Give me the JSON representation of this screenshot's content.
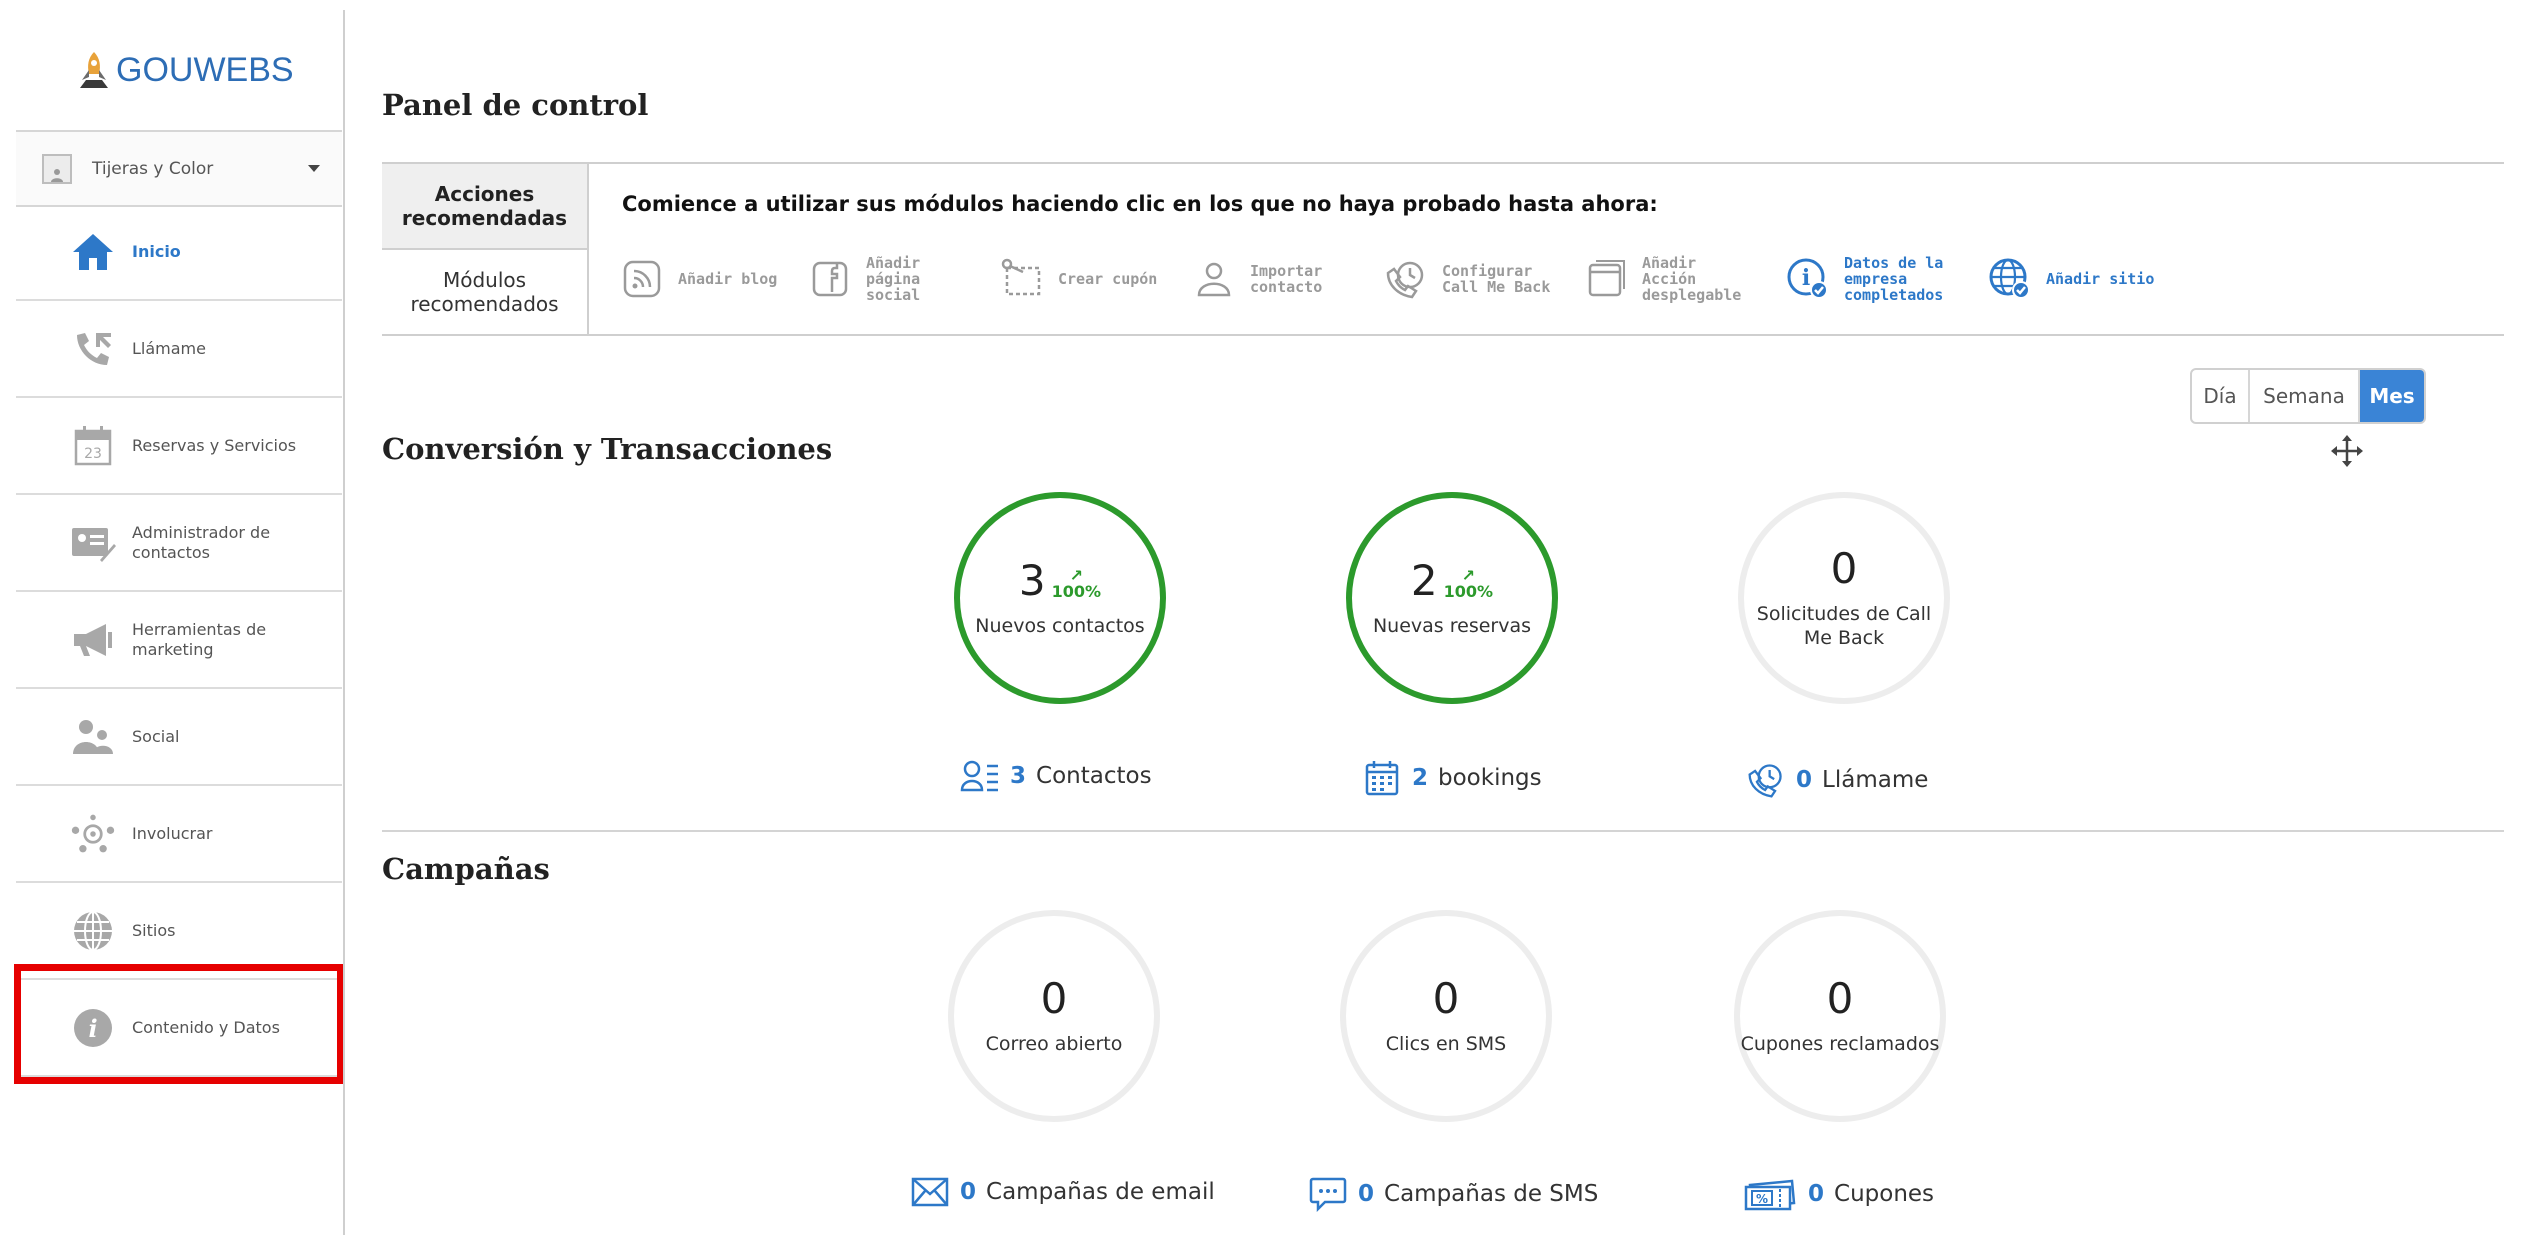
{
  "brand": {
    "name": "GOUWEBS"
  },
  "account": {
    "name": "Tijeras y Color"
  },
  "sidebar": {
    "items": [
      {
        "label": "Inicio",
        "icon": "home-icon",
        "active": true
      },
      {
        "label": "Llámame",
        "icon": "phone-icon"
      },
      {
        "label": "Reservas y Servicios",
        "icon": "calendar-icon"
      },
      {
        "label": "Administrador de contactos",
        "icon": "contact-card-icon"
      },
      {
        "label": "Herramientas de marketing",
        "icon": "megaphone-icon"
      },
      {
        "label": "Social",
        "icon": "people-icon"
      },
      {
        "label": "Involucrar",
        "icon": "engage-icon"
      },
      {
        "label": "Sitios",
        "icon": "globe-icon"
      },
      {
        "label": "Contenido y Datos",
        "icon": "info-icon"
      }
    ]
  },
  "dashboard": {
    "title": "Panel de control",
    "tabs": {
      "actions": "Acciones recomendadas",
      "modules": "Módulos recomendados"
    },
    "intro": "Comience a utilizar sus módulos haciendo clic en los que no haya probado hasta ahora:",
    "modules": [
      {
        "label": "Añadir blog",
        "icon": "rss-icon"
      },
      {
        "label": "Añadir página social",
        "icon": "facebook-icon"
      },
      {
        "label": "Crear cupón",
        "icon": "coupon-icon"
      },
      {
        "label": "Importar contacto",
        "icon": "person-icon"
      },
      {
        "label": "Configurar Call Me Back",
        "icon": "callback-icon"
      },
      {
        "label": "Añadir Acción desplegable",
        "icon": "window-icon"
      },
      {
        "label": "Datos de la empresa completados",
        "icon": "info-check-icon",
        "done": true
      },
      {
        "label": "Añadir sitio",
        "icon": "globe-check-icon",
        "done": true
      }
    ],
    "period": {
      "options": [
        "Día",
        "Semana",
        "Mes"
      ],
      "selected": "Mes"
    }
  },
  "conversion": {
    "title": "Conversión y Transacciones",
    "stats": [
      {
        "value": "3",
        "change": "100%",
        "label": "Nuevos contactos",
        "link_count": "3",
        "link_label": "Contactos",
        "icon": "contacts-icon"
      },
      {
        "value": "2",
        "change": "100%",
        "label": "Nuevas reservas",
        "link_count": "2",
        "link_label": "bookings",
        "icon": "calendar-grid-icon"
      },
      {
        "value": "0",
        "change": "",
        "label": "Solicitudes de Call Me Back",
        "link_count": "0",
        "link_label": "Llámame",
        "icon": "callback-icon"
      }
    ]
  },
  "campaigns": {
    "title": "Campañas",
    "stats": [
      {
        "value": "0",
        "label": "Correo abierto",
        "link_count": "0",
        "link_label": "Campañas de email",
        "icon": "envelope-icon"
      },
      {
        "value": "0",
        "label": "Clics en SMS",
        "link_count": "0",
        "link_label": "Campañas de SMS",
        "icon": "sms-icon"
      },
      {
        "value": "0",
        "label": "Cupones reclamados",
        "link_count": "0",
        "link_label": "Cupones",
        "icon": "coupon-icon"
      }
    ]
  },
  "colors": {
    "accent": "#2d78c8",
    "positive": "#2c9a2c",
    "highlight": "#e60000"
  }
}
